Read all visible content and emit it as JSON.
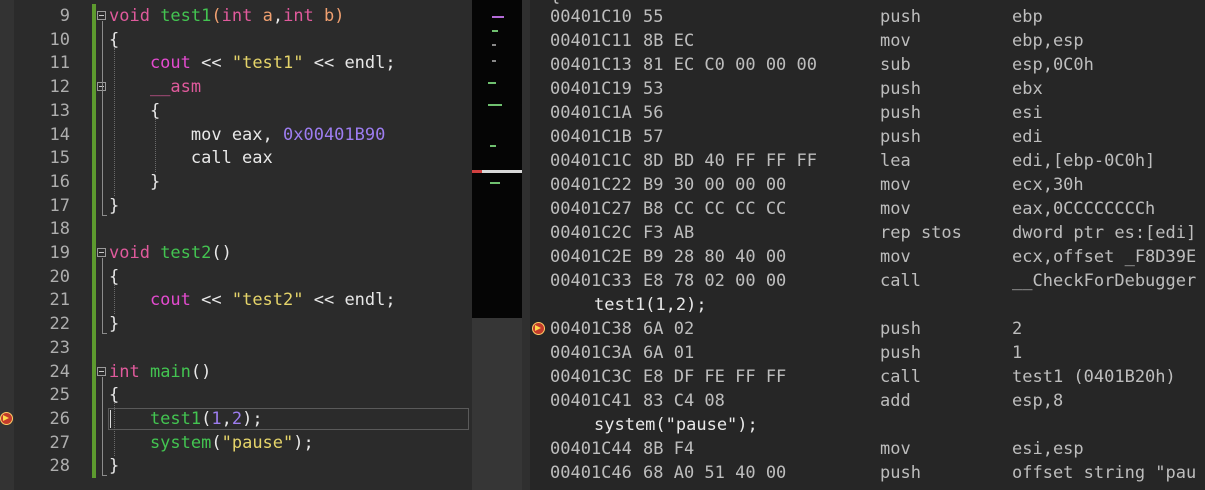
{
  "code": {
    "lines": [
      {
        "num": "9",
        "tokens": [
          {
            "t": "void ",
            "c": "kw"
          },
          {
            "t": "test1",
            "c": "fn"
          },
          {
            "t": "(",
            "c": "par"
          },
          {
            "t": "int ",
            "c": "kw"
          },
          {
            "t": "a",
            "c": "par"
          },
          {
            "t": ",",
            "c": "plain"
          },
          {
            "t": "int ",
            "c": "kw"
          },
          {
            "t": "b",
            "c": "par"
          },
          {
            "t": ")",
            "c": "par"
          }
        ]
      },
      {
        "num": "10",
        "tokens": [
          {
            "t": "{",
            "c": "plain"
          }
        ]
      },
      {
        "num": "11",
        "tokens": [
          {
            "t": "    cout ",
            "c": "ident"
          },
          {
            "t": "<< ",
            "c": "plain"
          },
          {
            "t": "\"test1\"",
            "c": "str"
          },
          {
            "t": " << endl;",
            "c": "plain"
          }
        ]
      },
      {
        "num": "12",
        "tokens": [
          {
            "t": "    __asm",
            "c": "kw"
          }
        ]
      },
      {
        "num": "13",
        "tokens": [
          {
            "t": "    {",
            "c": "plain"
          }
        ]
      },
      {
        "num": "14",
        "tokens": [
          {
            "t": "        mov eax, ",
            "c": "plain"
          },
          {
            "t": "0x00401B90",
            "c": "num"
          }
        ]
      },
      {
        "num": "15",
        "tokens": [
          {
            "t": "        call eax",
            "c": "plain"
          }
        ]
      },
      {
        "num": "16",
        "tokens": [
          {
            "t": "    }",
            "c": "plain"
          }
        ]
      },
      {
        "num": "17",
        "tokens": [
          {
            "t": "}",
            "c": "plain"
          }
        ]
      },
      {
        "num": "18",
        "tokens": []
      },
      {
        "num": "19",
        "tokens": [
          {
            "t": "void ",
            "c": "kw"
          },
          {
            "t": "test2",
            "c": "fn"
          },
          {
            "t": "()",
            "c": "plain"
          }
        ]
      },
      {
        "num": "20",
        "tokens": [
          {
            "t": "{",
            "c": "plain"
          }
        ]
      },
      {
        "num": "21",
        "tokens": [
          {
            "t": "    cout ",
            "c": "ident"
          },
          {
            "t": "<< ",
            "c": "plain"
          },
          {
            "t": "\"test2\"",
            "c": "str"
          },
          {
            "t": " << endl;",
            "c": "plain"
          }
        ]
      },
      {
        "num": "22",
        "tokens": [
          {
            "t": "}",
            "c": "plain"
          }
        ]
      },
      {
        "num": "23",
        "tokens": []
      },
      {
        "num": "24",
        "tokens": [
          {
            "t": "int ",
            "c": "kw"
          },
          {
            "t": "main",
            "c": "fn"
          },
          {
            "t": "()",
            "c": "plain"
          }
        ]
      },
      {
        "num": "25",
        "tokens": [
          {
            "t": "{",
            "c": "plain"
          }
        ]
      },
      {
        "num": "26",
        "tokens": [
          {
            "t": "    test1",
            "c": "fn"
          },
          {
            "t": "(",
            "c": "plain"
          },
          {
            "t": "1",
            "c": "num"
          },
          {
            "t": ",",
            "c": "plain"
          },
          {
            "t": "2",
            "c": "num"
          },
          {
            "t": ");",
            "c": "plain"
          }
        ]
      },
      {
        "num": "27",
        "tokens": [
          {
            "t": "    system",
            "c": "fn"
          },
          {
            "t": "(",
            "c": "plain"
          },
          {
            "t": "\"pause\"",
            "c": "str"
          },
          {
            "t": ");",
            "c": "plain"
          }
        ]
      },
      {
        "num": "28",
        "tokens": [
          {
            "t": "}",
            "c": "plain"
          }
        ]
      }
    ],
    "current_line": "26",
    "fold_lines": [
      "9",
      "12",
      "19",
      "24"
    ]
  },
  "disassembly": {
    "lines": [
      {
        "kind": "asm",
        "addr": "00401C10",
        "bytes": "55",
        "mnem": "push",
        "opnd": "ebp"
      },
      {
        "kind": "asm",
        "addr": "00401C11",
        "bytes": "8B EC",
        "mnem": "mov",
        "opnd": "ebp,esp"
      },
      {
        "kind": "asm",
        "addr": "00401C13",
        "bytes": "81 EC C0 00 00 00",
        "mnem": "sub",
        "opnd": "esp,0C0h"
      },
      {
        "kind": "asm",
        "addr": "00401C19",
        "bytes": "53",
        "mnem": "push",
        "opnd": "ebx"
      },
      {
        "kind": "asm",
        "addr": "00401C1A",
        "bytes": "56",
        "mnem": "push",
        "opnd": "esi"
      },
      {
        "kind": "asm",
        "addr": "00401C1B",
        "bytes": "57",
        "mnem": "push",
        "opnd": "edi"
      },
      {
        "kind": "asm",
        "addr": "00401C1C",
        "bytes": "8D BD 40 FF FF FF",
        "mnem": "lea",
        "opnd": "edi,[ebp-0C0h]"
      },
      {
        "kind": "asm",
        "addr": "00401C22",
        "bytes": "B9 30 00 00 00",
        "mnem": "mov",
        "opnd": "ecx,30h"
      },
      {
        "kind": "asm",
        "addr": "00401C27",
        "bytes": "B8 CC CC CC CC",
        "mnem": "mov",
        "opnd": "eax,0CCCCCCCCh"
      },
      {
        "kind": "asm",
        "addr": "00401C2C",
        "bytes": "F3 AB",
        "mnem": "rep stos",
        "opnd": "dword ptr es:[edi]"
      },
      {
        "kind": "asm",
        "addr": "00401C2E",
        "bytes": "B9 28 80 40 00",
        "mnem": "mov",
        "opnd": "ecx,offset _F8D39E"
      },
      {
        "kind": "asm",
        "addr": "00401C33",
        "bytes": "E8 78 02 00 00",
        "mnem": "call",
        "opnd": "__CheckForDebugger"
      },
      {
        "kind": "src",
        "text": "test1(1,2);"
      },
      {
        "kind": "asm",
        "addr": "00401C38",
        "bytes": "6A 02",
        "mnem": "push",
        "opnd": "2",
        "current": true
      },
      {
        "kind": "asm",
        "addr": "00401C3A",
        "bytes": "6A 01",
        "mnem": "push",
        "opnd": "1"
      },
      {
        "kind": "asm",
        "addr": "00401C3C",
        "bytes": "E8 DF FE FF FF",
        "mnem": "call",
        "opnd": "test1 (0401B20h)"
      },
      {
        "kind": "asm",
        "addr": "00401C41",
        "bytes": "83 C4 08",
        "mnem": "add",
        "opnd": "esp,8"
      },
      {
        "kind": "src",
        "text": "system(\"pause\");"
      },
      {
        "kind": "asm",
        "addr": "00401C44",
        "bytes": "8B F4",
        "mnem": "mov",
        "opnd": "esi,esp"
      },
      {
        "kind": "asm",
        "addr": "00401C46",
        "bytes": "68 A0 51 40 00",
        "mnem": "push",
        "opnd": "offset string \"pau"
      }
    ],
    "top_sliver": "{"
  },
  "colors": {
    "keyword": "#e05a9c",
    "function": "#43c451",
    "param": "#f0a070",
    "string": "#e5d46a",
    "number": "#9d7df0",
    "identifier": "#e34bcf",
    "change_bar": "#5d9a2f",
    "breakpoint_arrow": "#ffd84a"
  },
  "icons": {
    "current_statement": "yellow-arrow-icon",
    "fold": "collapse-box-icon"
  }
}
